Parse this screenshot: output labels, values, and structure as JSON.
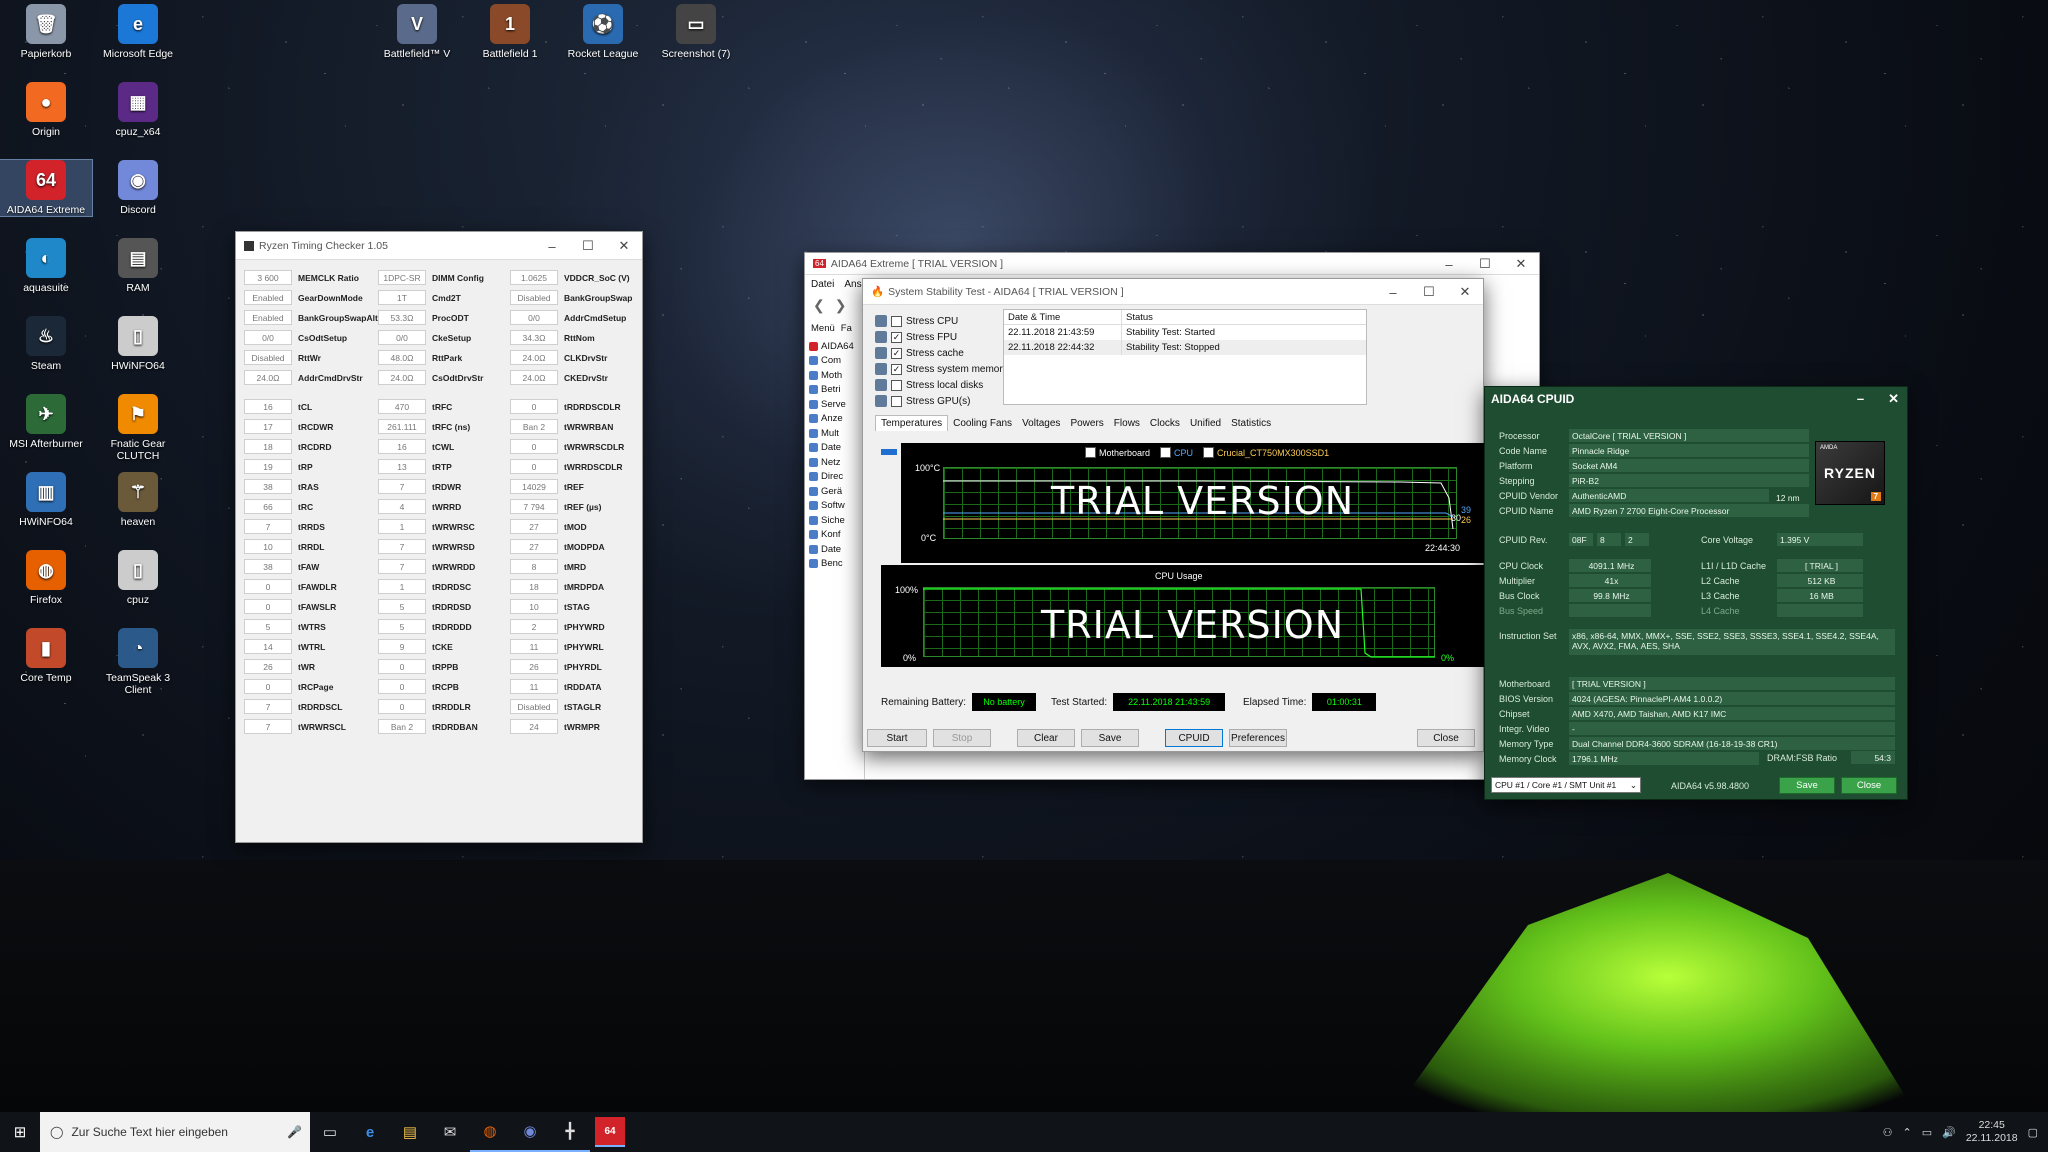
{
  "desktop": {
    "icons": [
      {
        "label": "Papierkorb",
        "glyph": "🗑",
        "color": "#8a97a8"
      },
      {
        "label": "Microsoft Edge",
        "glyph": "e",
        "color": "#1b78d6"
      },
      {
        "label": "Origin",
        "glyph": "●",
        "color": "#f26a21"
      },
      {
        "label": "cpuz_x64",
        "glyph": "▦",
        "color": "#5b2a86"
      },
      {
        "label": "AIDA64 Extreme",
        "glyph": "64",
        "color": "#d2232a"
      },
      {
        "label": "Discord",
        "glyph": "◉",
        "color": "#7289da"
      },
      {
        "label": "aquasuite",
        "glyph": "◐",
        "color": "#1e88c8"
      },
      {
        "label": "RAM",
        "glyph": "▤",
        "color": "#555"
      },
      {
        "label": "Steam",
        "glyph": "♨",
        "color": "#1b2838"
      },
      {
        "label": "HWiNFO64",
        "glyph": "▯",
        "color": "#ccc"
      },
      {
        "label": "MSI Afterburner",
        "glyph": "✈",
        "color": "#2c6b38"
      },
      {
        "label": "Fnatic Gear CLUTCH",
        "glyph": "⚑",
        "color": "#f08a00"
      },
      {
        "label": "HWiNFO64",
        "glyph": "▥",
        "color": "#2f6fb5"
      },
      {
        "label": "heaven",
        "glyph": "⚚",
        "color": "#6b5a3a"
      },
      {
        "label": "Firefox",
        "glyph": "◍",
        "color": "#e66000"
      },
      {
        "label": "cpuz",
        "glyph": "▯",
        "color": "#ccc"
      },
      {
        "label": "Core Temp",
        "glyph": "▮",
        "color": "#c24a2a"
      },
      {
        "label": "TeamSpeak 3 Client",
        "glyph": "◔",
        "color": "#2b5a8a"
      }
    ],
    "top_icons": [
      {
        "label": "Battlefield™ V",
        "glyph": "V",
        "color": "#5a6a8a"
      },
      {
        "label": "Battlefield 1",
        "glyph": "1",
        "color": "#8a4a2a"
      },
      {
        "label": "Rocket League",
        "glyph": "⚽",
        "color": "#2a6ab0"
      },
      {
        "label": "Screenshot (7)",
        "glyph": "▭",
        "color": "#444"
      }
    ]
  },
  "rtc": {
    "title": "Ryzen Timing Checker 1.05",
    "rows_a": [
      [
        "3 600",
        "MEMCLK Ratio",
        "1DPC-SR",
        "DIMM Config",
        "1.0625",
        "VDDCR_SoC (V)"
      ],
      [
        "Enabled",
        "GearDownMode",
        "1T",
        "Cmd2T",
        "Disabled",
        "BankGroupSwap"
      ],
      [
        "Enabled",
        "BankGroupSwapAlt",
        "53.3Ω",
        "ProcODT",
        "0/0",
        "AddrCmdSetup"
      ],
      [
        "0/0",
        "CsOdtSetup",
        "0/0",
        "CkeSetup",
        "34.3Ω",
        "RttNom"
      ],
      [
        "Disabled",
        "RttWr",
        "48.0Ω",
        "RttPark",
        "24.0Ω",
        "CLKDrvStr"
      ],
      [
        "24.0Ω",
        "AddrCmdDrvStr",
        "24.0Ω",
        "CsOdtDrvStr",
        "24.0Ω",
        "CKEDrvStr"
      ]
    ],
    "rows_b": [
      [
        "16",
        "tCL",
        "470",
        "tRFC",
        "0",
        "tRDRDSCDLR"
      ],
      [
        "17",
        "tRCDWR",
        "261.111",
        "tRFC (ns)",
        "Ban 2",
        "tWRWRBAN"
      ],
      [
        "18",
        "tRCDRD",
        "16",
        "tCWL",
        "0",
        "tWRWRSCDLR"
      ],
      [
        "19",
        "tRP",
        "13",
        "tRTP",
        "0",
        "tWRRDSCDLR"
      ],
      [
        "38",
        "tRAS",
        "7",
        "tRDWR",
        "14029",
        "tREF"
      ],
      [
        "66",
        "tRC",
        "4",
        "tWRRD",
        "7 794",
        "tREF (µs)"
      ],
      [
        "7",
        "tRRDS",
        "1",
        "tWRWRSC",
        "27",
        "tMOD"
      ],
      [
        "10",
        "tRRDL",
        "7",
        "tWRWRSD",
        "27",
        "tMODPDA"
      ],
      [
        "38",
        "tFAW",
        "7",
        "tWRWRDD",
        "8",
        "tMRD"
      ],
      [
        "0",
        "tFAWDLR",
        "1",
        "tRDRDSC",
        "18",
        "tMRDPDA"
      ],
      [
        "0",
        "tFAWSLR",
        "5",
        "tRDRDSD",
        "10",
        "tSTAG"
      ],
      [
        "5",
        "tWTRS",
        "5",
        "tRDRDDD",
        "2",
        "tPHYWRD"
      ],
      [
        "14",
        "tWTRL",
        "9",
        "tCKE",
        "11",
        "tPHYWRL"
      ],
      [
        "26",
        "tWR",
        "0",
        "tRPPB",
        "26",
        "tPHYRDL"
      ],
      [
        "0",
        "tRCPage",
        "0",
        "tRCPB",
        "11",
        "tRDDATA"
      ],
      [
        "7",
        "tRDRDSCL",
        "0",
        "tRRDDLR",
        "Disabled",
        "tSTAGLR"
      ],
      [
        "7",
        "tWRWRSCL",
        "Ban 2",
        "tRDRDBAN",
        "24",
        "tWRMPR"
      ]
    ]
  },
  "aida": {
    "title": "AIDA64 Extreme  [ TRIAL VERSION ]",
    "menu": [
      "Datei",
      "Ansi"
    ],
    "menu_label": "Menü",
    "fav_label": "Fa",
    "tree": [
      "AIDA64",
      "Com",
      "Moth",
      "Betri",
      "Serve",
      "Anze",
      "Mult",
      "Date",
      "Netz",
      "Direc",
      "Gerä",
      "Softw",
      "Siche",
      "Konf",
      "Date",
      "Benc"
    ]
  },
  "sst": {
    "title": "System Stability Test - AIDA64  [ TRIAL VERSION ]",
    "stress": [
      {
        "label": "Stress CPU",
        "checked": false
      },
      {
        "label": "Stress FPU",
        "checked": true
      },
      {
        "label": "Stress cache",
        "checked": true
      },
      {
        "label": "Stress system memory",
        "checked": true
      },
      {
        "label": "Stress local disks",
        "checked": false
      },
      {
        "label": "Stress GPU(s)",
        "checked": false
      }
    ],
    "log_headers": [
      "Date & Time",
      "Status"
    ],
    "log": [
      [
        "22.11.2018 21:43:59",
        "Stability Test: Started"
      ],
      [
        "22.11.2018 22:44:32",
        "Stability Test: Stopped"
      ]
    ],
    "tabs": [
      "Temperatures",
      "Cooling Fans",
      "Voltages",
      "Powers",
      "Flows",
      "Clocks",
      "Unified",
      "Statistics"
    ],
    "temp_legend": [
      "Motherboard",
      "CPU",
      "Crucial_CT750MX300SSD1"
    ],
    "temp_top": "100°C",
    "temp_bottom": "0°C",
    "temp_time": "22:44:30",
    "temp_values": [
      "39",
      "30",
      "26"
    ],
    "trial_text": "TRIAL VERSION",
    "cpu_title": "CPU Usage",
    "cpu_top": "100%",
    "cpu_bottom": "0%",
    "cpu_now": "0%",
    "battery_label": "Remaining Battery:",
    "battery_value": "No battery",
    "started_label": "Test Started:",
    "started_value": "22.11.2018 21:43:59",
    "elapsed_label": "Elapsed Time:",
    "elapsed_value": "01:00:31",
    "buttons": {
      "start": "Start",
      "stop": "Stop",
      "clear": "Clear",
      "save": "Save",
      "cpuid": "CPUID",
      "prefs": "Preferences",
      "close": "Close"
    }
  },
  "cpuid": {
    "title": "AIDA64 CPUID",
    "left": [
      [
        "Processor",
        "OctalCore [ TRIAL VERSION ]"
      ],
      [
        "Code Name",
        "Pinnacle Ridge"
      ],
      [
        "Platform",
        "Socket AM4"
      ],
      [
        "Stepping",
        "PiR-B2"
      ],
      [
        "CPUID Vendor",
        "AuthenticAMD"
      ],
      [
        "CPUID Name",
        "AMD Ryzen 7 2700 Eight-Core Processor"
      ]
    ],
    "process": "12 nm",
    "rev_label": "CPUID Rev.",
    "rev": [
      "08F",
      "8",
      "2"
    ],
    "core_voltage_label": "Core Voltage",
    "core_voltage": "1.395 V",
    "clocks": [
      [
        "CPU Clock",
        "4091.1 MHz",
        "L1I / L1D Cache",
        "[ TRIAL ]"
      ],
      [
        "Multiplier",
        "41x",
        "L2 Cache",
        "512 KB"
      ],
      [
        "Bus Clock",
        "99.8 MHz",
        "L3 Cache",
        "16 MB"
      ],
      [
        "Bus Speed",
        "",
        "L4 Cache",
        ""
      ]
    ],
    "iset_label": "Instruction Set",
    "iset": "x86, x86-64, MMX, MMX+, SSE, SSE2, SSE3, SSSE3, SSE4.1, SSE4.2, SSE4A, AVX, AVX2, FMA, AES, SHA",
    "board": [
      [
        "Motherboard",
        "[ TRIAL VERSION ]"
      ],
      [
        "BIOS Version",
        "4024  (AGESA: PinnaclePI-AM4 1.0.0.2)"
      ],
      [
        "Chipset",
        "AMD X470, AMD Taishan, AMD K17 IMC"
      ],
      [
        "Integr. Video",
        "-"
      ],
      [
        "Memory Type",
        "Dual Channel DDR4-3600 SDRAM  (16-18-19-38 CR1)"
      ],
      [
        "Memory Clock",
        "1796.1 MHz"
      ]
    ],
    "dram_ratio_label": "DRAM:FSB Ratio",
    "dram_ratio": "54:3",
    "selector": "CPU #1 / Core #1 / SMT Unit #1",
    "version": "AIDA64 v5.98.4800",
    "save": "Save",
    "close": "Close",
    "logo_amd": "AMDA",
    "logo_brand": "RYZEN",
    "logo_tier": "7"
  },
  "taskbar": {
    "search_placeholder": "Zur Suche Text hier eingeben",
    "time": "22:45",
    "date": "22.11.2018"
  }
}
